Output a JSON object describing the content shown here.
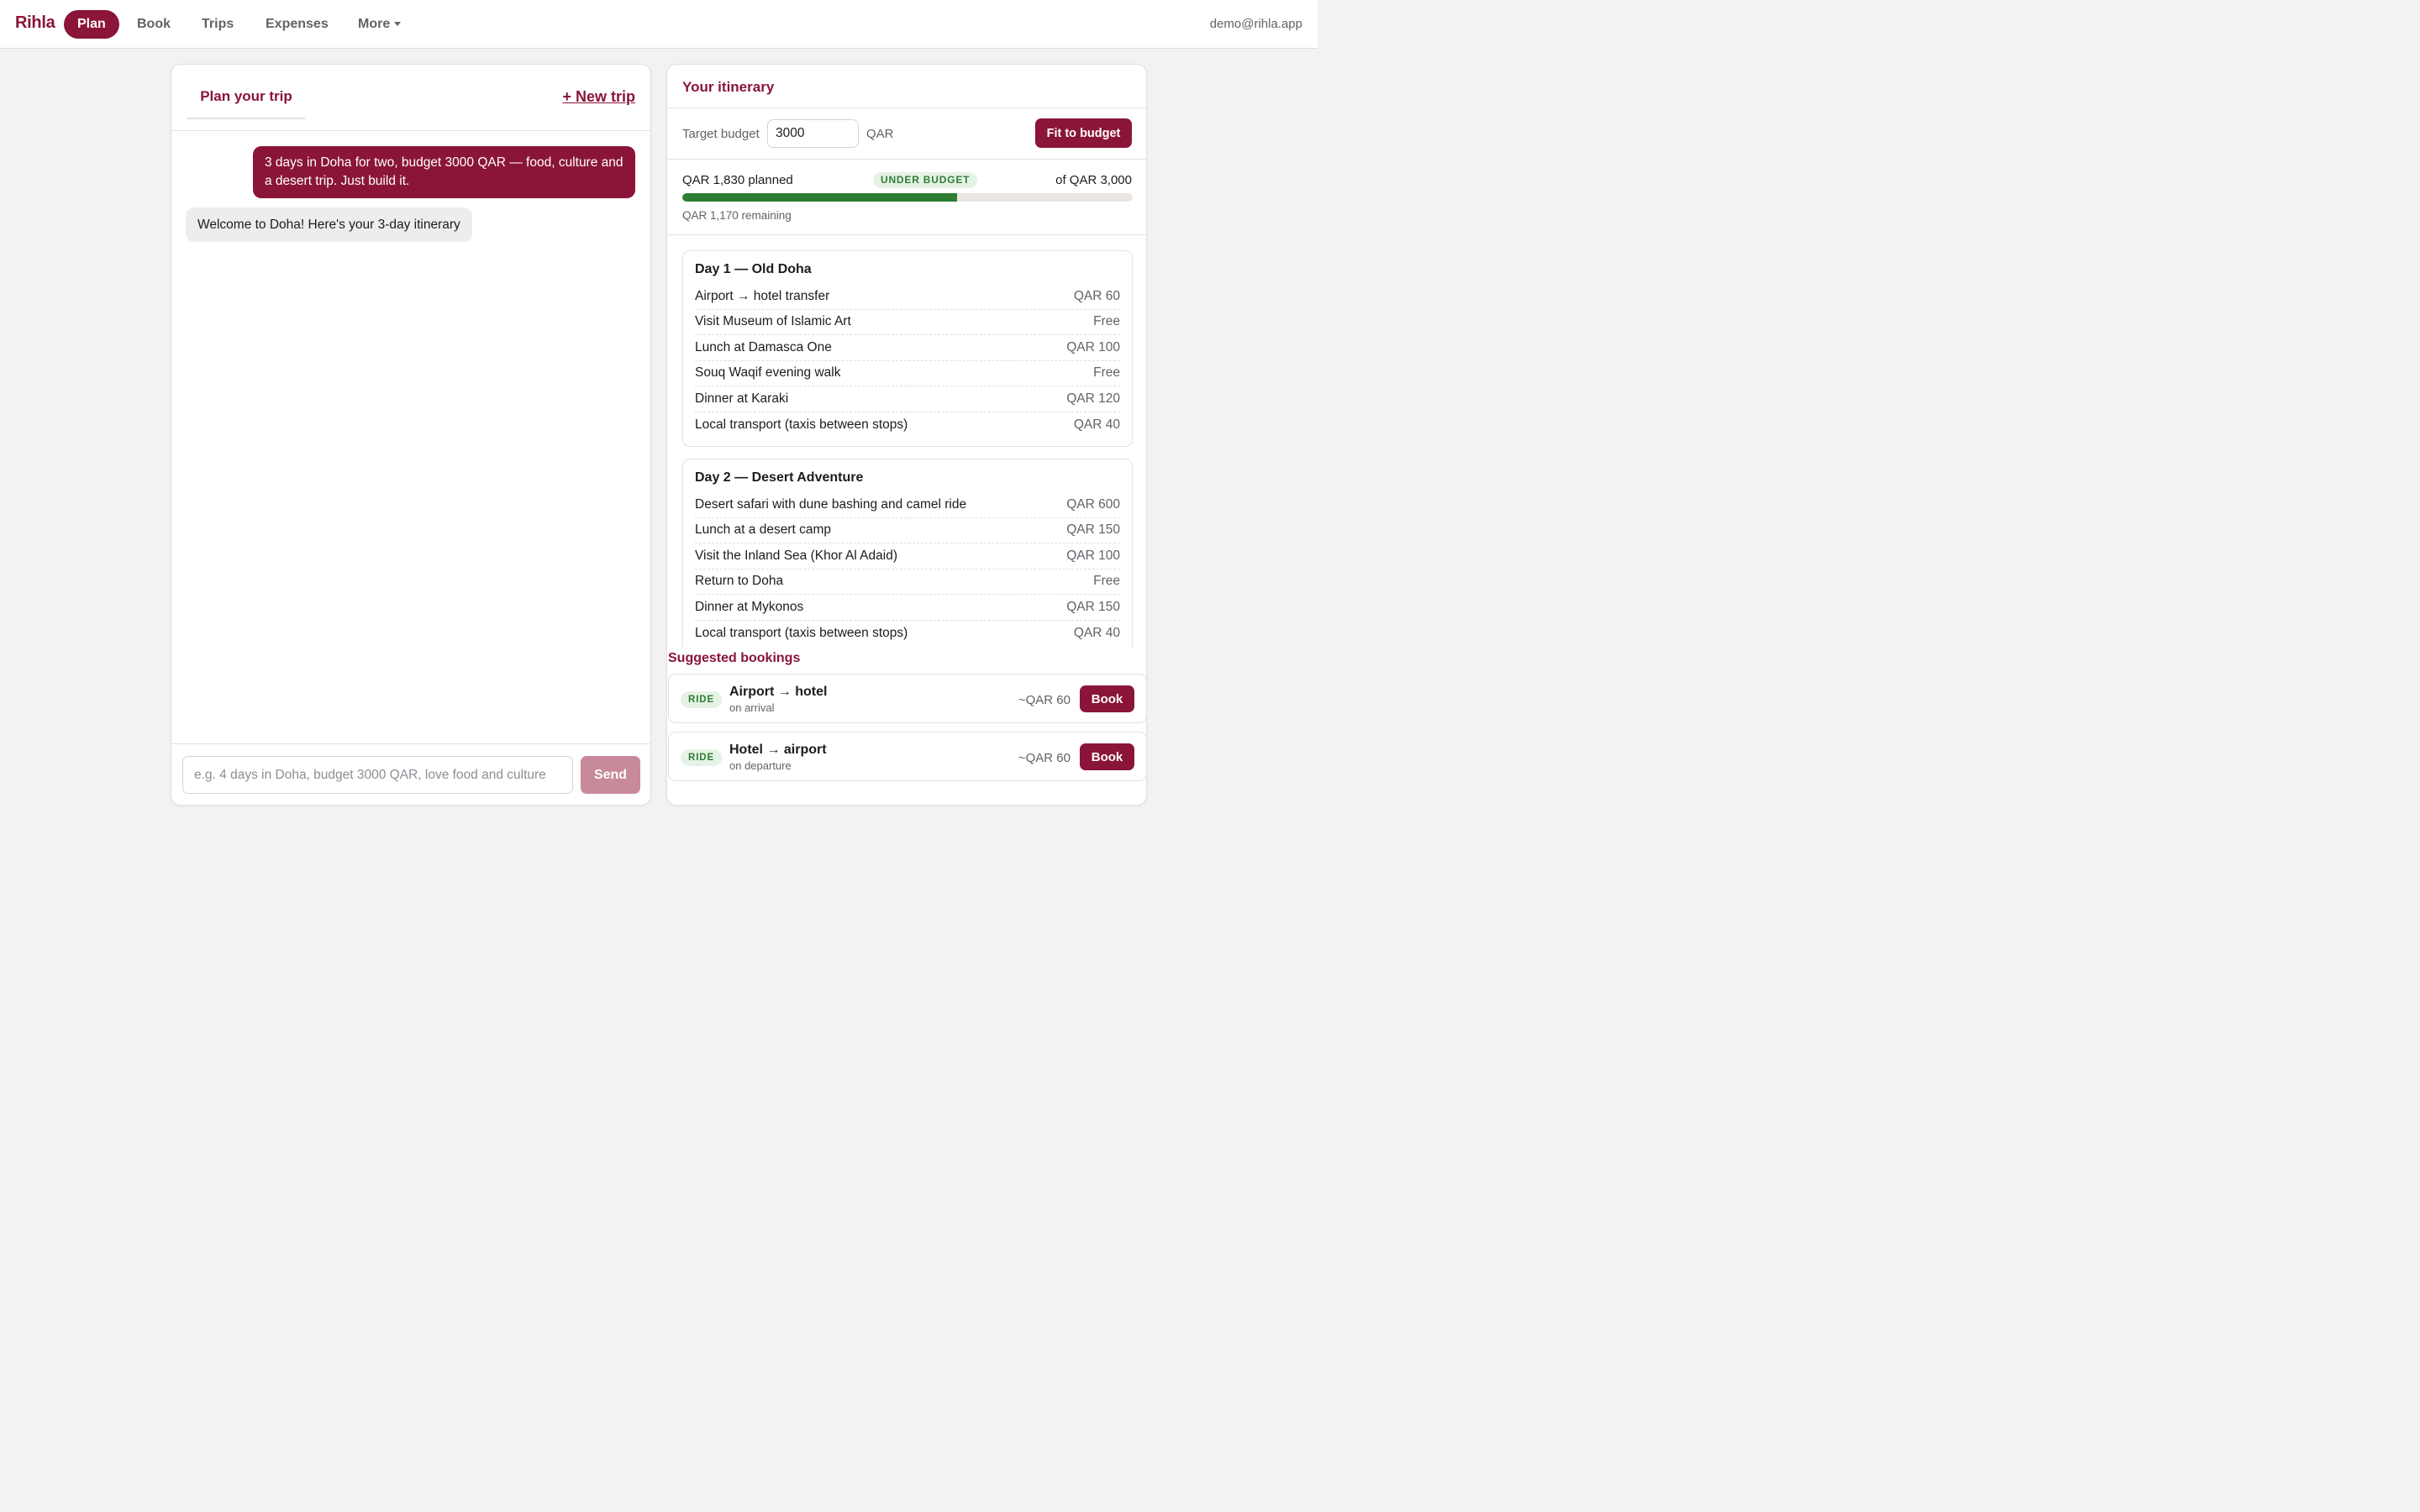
{
  "app": {
    "brand": "Rihla",
    "user_email": "demo@rihla.app"
  },
  "nav": {
    "items": [
      {
        "label": "Plan",
        "active": true
      },
      {
        "label": "Book",
        "active": false
      },
      {
        "label": "Trips",
        "active": false
      },
      {
        "label": "Expenses",
        "active": false
      },
      {
        "label": "More",
        "active": false,
        "has_dropdown": true
      }
    ]
  },
  "chat": {
    "tab_label": "Plan your trip",
    "new_trip_label": "+ New trip",
    "messages": [
      {
        "role": "user",
        "text": "3 days in Doha for two, budget 3000 QAR — food, culture and a desert trip. Just build it."
      },
      {
        "role": "assistant",
        "text": "Welcome to Doha! Here's your 3-day itinerary"
      }
    ],
    "input_value": "",
    "input_placeholder": "e.g. 4 days in Doha, budget 3000 QAR, love food and culture",
    "send_label": "Send"
  },
  "itinerary": {
    "title": "Your itinerary",
    "budget": {
      "label": "Target budget",
      "value": "3000",
      "currency": "QAR",
      "fit_button_label": "Fit to budget",
      "planned_text": "QAR 1,830 planned",
      "status_badge": "UNDER BUDGET",
      "total_text": "of QAR 3,000",
      "remaining_text": "QAR 1,170 remaining",
      "progress_fraction": 0.61,
      "progress_color": "#2e7d32"
    },
    "days": [
      {
        "title": "Day 1 — Old Doha",
        "items": [
          {
            "name": "Airport → hotel transfer",
            "cost": "QAR 60"
          },
          {
            "name": "Visit Museum of Islamic Art",
            "cost": "Free"
          },
          {
            "name": "Lunch at Damasca One",
            "cost": "QAR 100"
          },
          {
            "name": "Souq Waqif evening walk",
            "cost": "Free"
          },
          {
            "name": "Dinner at Karaki",
            "cost": "QAR 120"
          },
          {
            "name": "Local transport (taxis between stops)",
            "cost": "QAR 40"
          }
        ]
      },
      {
        "title": "Day 2 — Desert Adventure",
        "items": [
          {
            "name": "Desert safari with dune bashing and camel ride",
            "cost": "QAR 600"
          },
          {
            "name": "Lunch at a desert camp",
            "cost": "QAR 150"
          },
          {
            "name": "Visit the Inland Sea (Khor Al Adaid)",
            "cost": "QAR 100"
          },
          {
            "name": "Return to Doha",
            "cost": "Free"
          },
          {
            "name": "Dinner at Mykonos",
            "cost": "QAR 150"
          },
          {
            "name": "Local transport (taxis between stops)",
            "cost": "QAR 40"
          }
        ]
      }
    ]
  },
  "suggested_bookings": {
    "title": "Suggested bookings",
    "items": [
      {
        "type": "RIDE",
        "name": "Airport → hotel",
        "when": "on arrival",
        "price": "~QAR 60",
        "button_label": "Book"
      },
      {
        "type": "RIDE",
        "name": "Hotel → airport",
        "when": "on departure",
        "price": "~QAR 60",
        "button_label": "Book"
      }
    ]
  },
  "colors": {
    "brand": "#8a1538",
    "success": "#2e7d32",
    "background": "#f3f2f1"
  }
}
